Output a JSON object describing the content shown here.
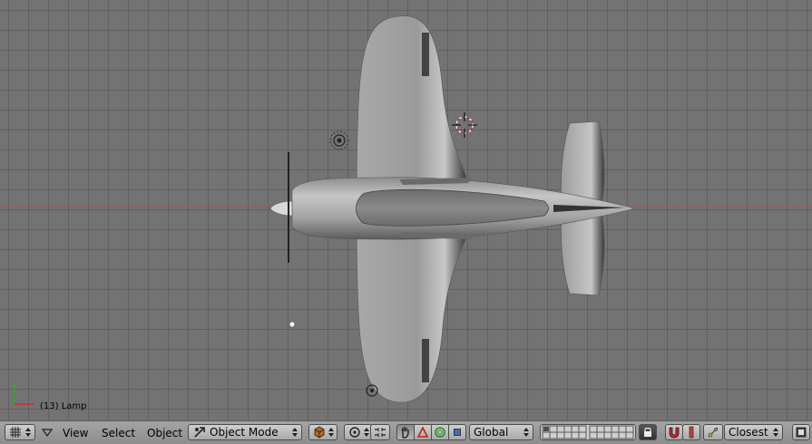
{
  "viewport": {
    "object_label": "(13) Lamp",
    "grid_color": "#737373"
  },
  "header": {
    "menus": [
      "View",
      "Select",
      "Object"
    ],
    "mode": {
      "label": "Object Mode",
      "icon": "object-mode-icon"
    },
    "orientation": {
      "label": "Global"
    },
    "snap_target": {
      "label": "Closest"
    },
    "icons": {
      "editor_type": "grid-icon",
      "collapse": "triangle-down-icon",
      "shading": "solid-shading-icon",
      "pivot": "pivot-icon",
      "proportional": "proportional-edit-icon",
      "manipulator": "hand-manipulator-icon",
      "translate": "translate-icon",
      "rotate": "rotate-icon",
      "scale": "scale-icon",
      "layers": "layers-icon",
      "lock": "lock-icon",
      "snap": "magnet-icon",
      "snap_element": "snap-element-icon",
      "render": "render-icon"
    }
  }
}
